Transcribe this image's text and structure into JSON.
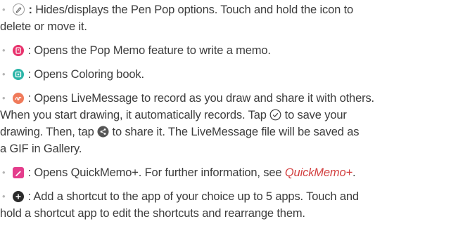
{
  "items": [
    {
      "icon": "pen-pop-icon",
      "sep": ":",
      "lines": [
        "Hides/displays the Pen Pop options. Touch and hold the icon to",
        "delete or move it."
      ]
    },
    {
      "icon": "pop-memo-icon",
      "sep": ":",
      "lines": [
        "Opens the Pop Memo feature to write a memo."
      ]
    },
    {
      "icon": "coloring-book-icon",
      "sep": ":",
      "lines": [
        "Opens Coloring book."
      ]
    },
    {
      "icon": "livemessage-icon",
      "sep": ":",
      "lines": [
        "Opens LiveMessage to record as you draw and share it with others.",
        "When you start drawing, it automatically records. Tap",
        "to save your",
        "drawing. Then, tap",
        "to share it. The LiveMessage file will be saved as",
        "a GIF in Gallery."
      ]
    },
    {
      "icon": "quickmemo-icon",
      "sep": ":",
      "lines": [
        "Opens QuickMemo+. For further information, see"
      ],
      "link": "QuickMemo+",
      "after_link": "."
    },
    {
      "icon": "add-shortcut-icon",
      "sep": ":",
      "lines": [
        "Add a shortcut to the app of your choice up to 5 apps. Touch and",
        "hold a shortcut app to edit the shortcuts and rearrange them."
      ]
    }
  ],
  "colors": {
    "text": "#3c3c3c",
    "bullet": "#b5b5b5",
    "link": "#d23f3f",
    "pop_memo": "#e8336d",
    "coloring": "#2cb5a8",
    "livemessage": "#f07a5a",
    "quickmemo": "#e43d8c",
    "add": "#2b2b2b"
  }
}
